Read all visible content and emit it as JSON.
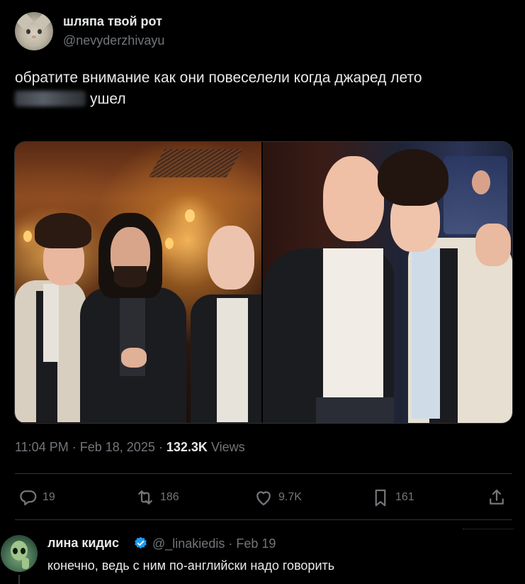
{
  "author": {
    "display_name": "шляпа твой рот",
    "handle": "@nevyderzhivayu",
    "avatar_icon": "cat-avatar-icon"
  },
  "tweet": {
    "text_line1": "обратите внимание как они повеселели когда джаред лето",
    "text_line2_visible": "ушел",
    "text_line2_blurred": true
  },
  "media": {
    "count": 2,
    "descriptions": []
  },
  "meta": {
    "time": "11:04 PM",
    "separator": "·",
    "date": "Feb 18, 2025",
    "views_count": "132.3K",
    "views_label": "Views"
  },
  "actions": {
    "replies": "19",
    "reposts": "186",
    "likes": "9.7K",
    "bookmarks": "161",
    "icons": [
      "reply-icon",
      "repost-icon",
      "like-icon",
      "bookmark-icon",
      "share-icon"
    ]
  },
  "reply": {
    "display_name": "лина кидис",
    "verified": true,
    "handle_date": "@_linakiedis · Feb 19",
    "text": "конечно, ведь с ним по-английски надо говорить"
  },
  "colors": {
    "background": "#000000",
    "primary_text": "#e7e9ea",
    "secondary_text": "#71767b",
    "border": "#2f3336",
    "verified_blue": "#1d9bf0"
  }
}
